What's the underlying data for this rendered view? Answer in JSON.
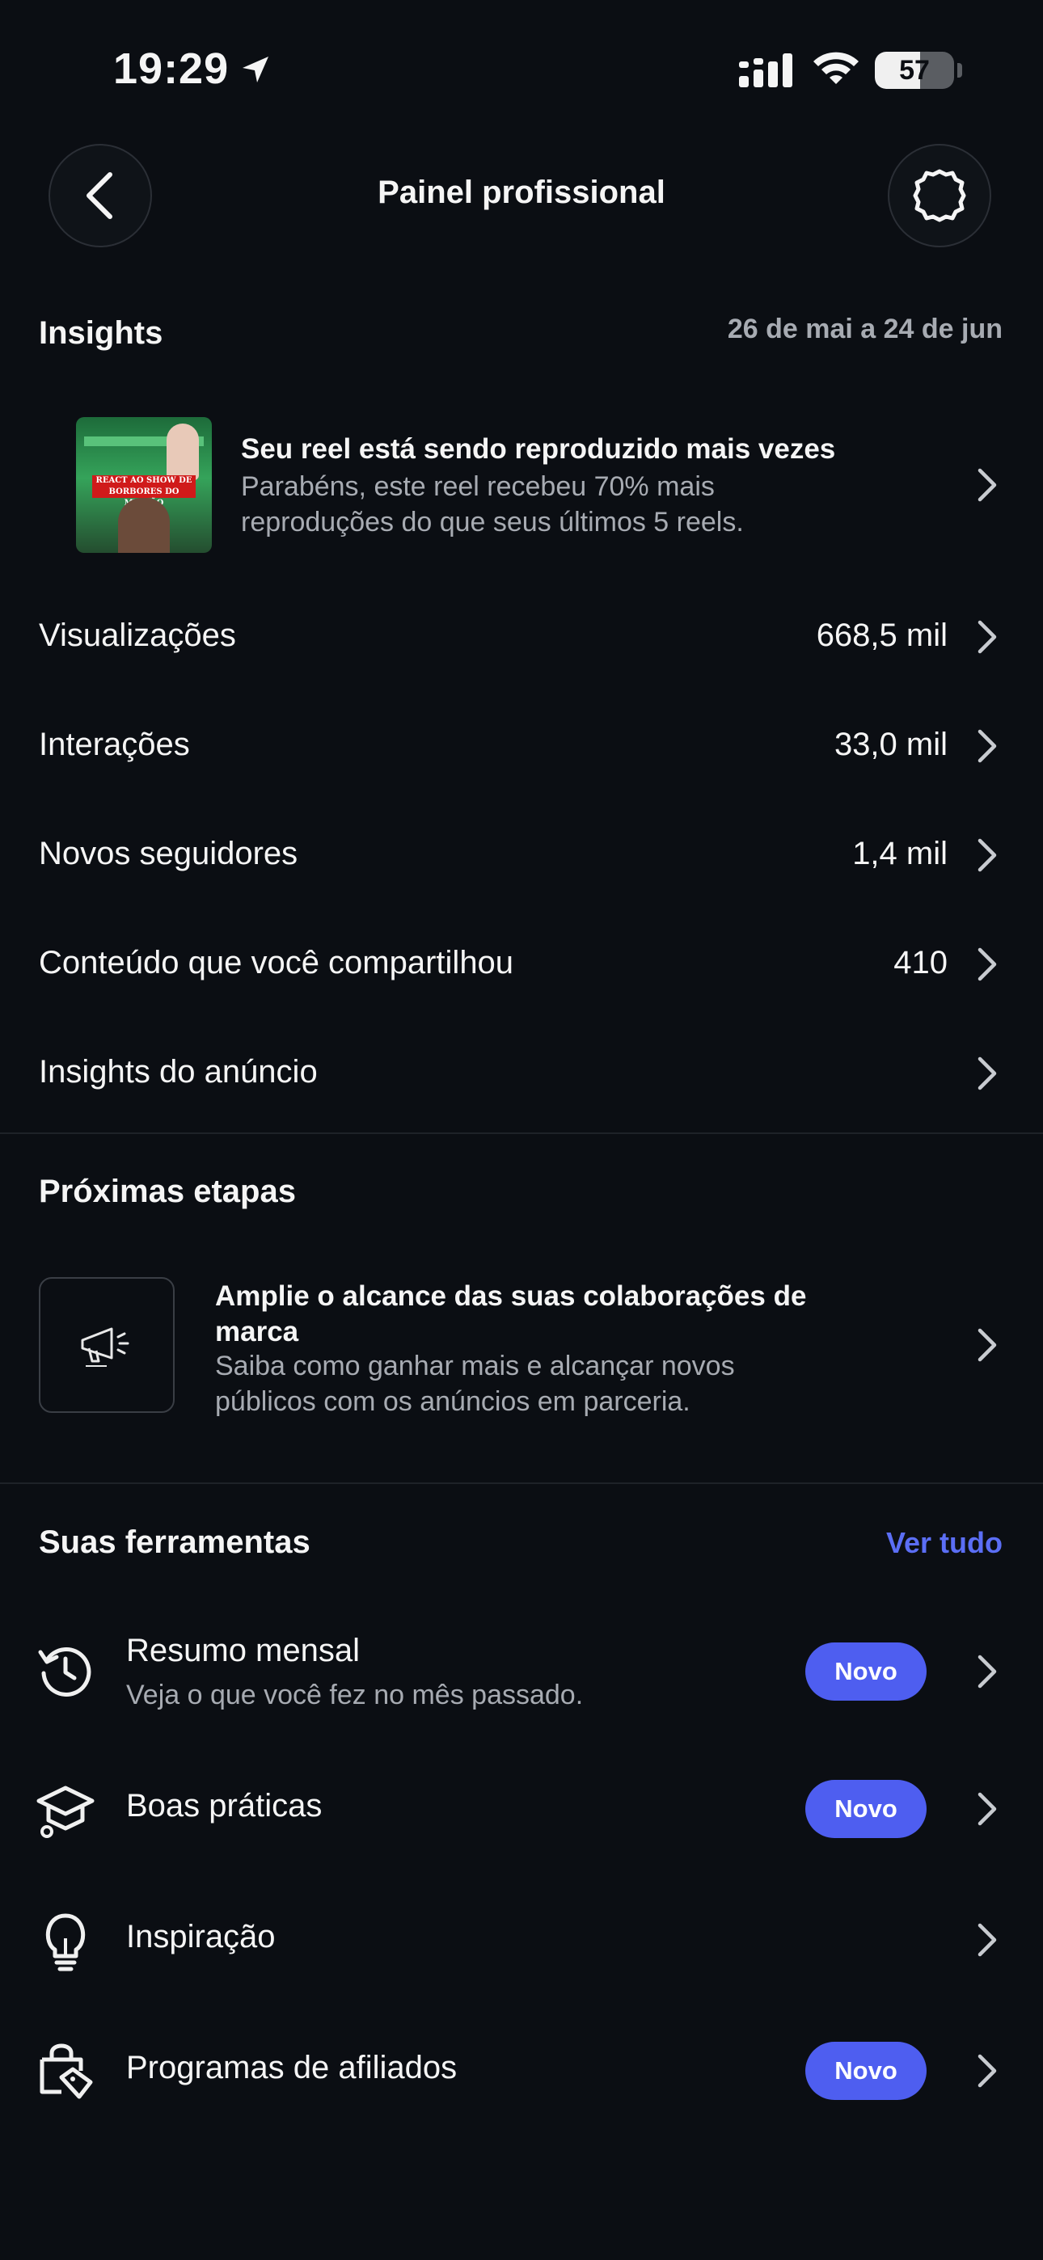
{
  "status_bar": {
    "time": "19:29",
    "battery": "57",
    "battery_level": 0.57
  },
  "header": {
    "title": "Painel profissional"
  },
  "insights": {
    "title": "Insights",
    "date_range": "26 de mai a 24 de jun",
    "reel_card": {
      "title": "Seu reel está sendo reproduzido mais vezes",
      "desc_line1": "Parabéns, este reel recebeu 70% mais",
      "desc_line2": "reproduções do que seus últimos 5 reels.",
      "thumb_text": "REACT AO SHOW DE BORBORES DO MILHÃO"
    },
    "metrics": [
      {
        "label": "Visualizações",
        "value": "668,5 mil"
      },
      {
        "label": "Interações",
        "value": "33,0 mil"
      },
      {
        "label": "Novos seguidores",
        "value": "1,4 mil"
      },
      {
        "label": "Conteúdo que você compartilhou",
        "value": "410"
      },
      {
        "label": "Insights do anúncio",
        "value": ""
      }
    ]
  },
  "next_steps": {
    "title": "Próximas etapas",
    "card": {
      "title_line1": "Amplie o alcance das suas colaborações de",
      "title_line2": "marca",
      "desc_line1": "Saiba como ganhar mais e alcançar novos",
      "desc_line2": "públicos com os anúncios em parceria."
    }
  },
  "tools": {
    "title": "Suas ferramentas",
    "see_all": "Ver tudo",
    "items": [
      {
        "label": "Resumo mensal",
        "sub": "Veja o que você fez no mês passado.",
        "badge": "Novo",
        "icon": "history-icon"
      },
      {
        "label": "Boas práticas",
        "sub": "",
        "badge": "Novo",
        "icon": "graduation-cap-icon"
      },
      {
        "label": "Inspiração",
        "sub": "",
        "badge": "",
        "icon": "lightbulb-icon"
      },
      {
        "label": "Programas de afiliados",
        "sub": "",
        "badge": "Novo",
        "icon": "shopping-bag-tag-icon"
      }
    ]
  },
  "colors": {
    "background": "#0b0e13",
    "accent": "#4e5ef0",
    "link": "#5b6ef5",
    "secondary_text": "#a7abb2"
  }
}
